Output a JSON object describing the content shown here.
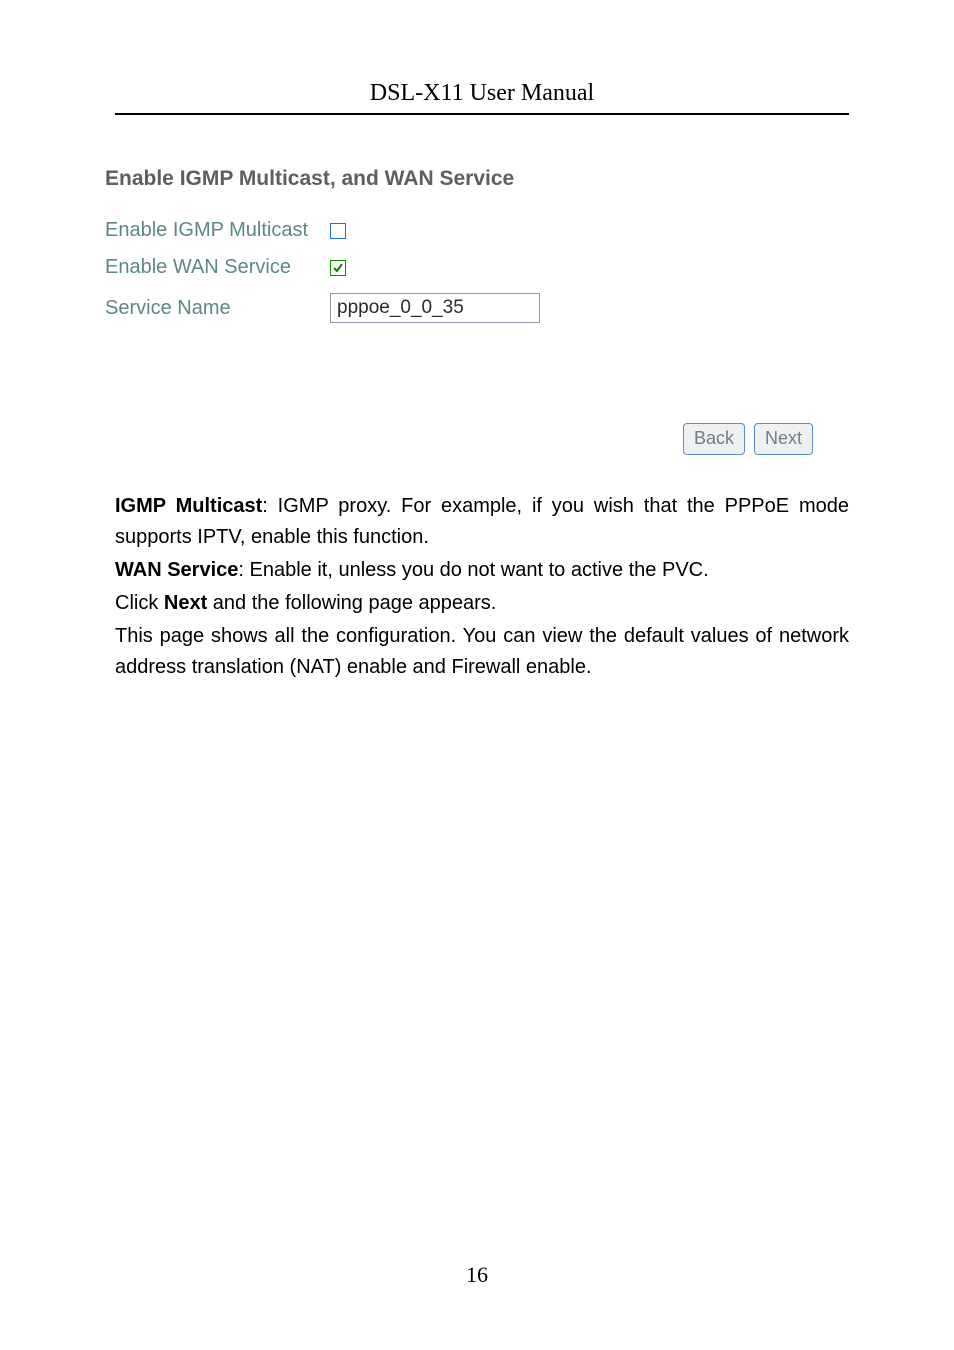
{
  "header": {
    "title": "DSL-X11 User Manual"
  },
  "ui": {
    "title": "Enable IGMP Multicast, and WAN Service",
    "rows": {
      "igmp": {
        "label": "Enable IGMP Multicast",
        "checked": false
      },
      "wan": {
        "label": "Enable WAN Service",
        "checked": true
      },
      "svc": {
        "label": "Service Name",
        "value": "pppoe_0_0_35"
      }
    },
    "buttons": {
      "back": "Back",
      "next": "Next"
    }
  },
  "body": {
    "p1_strong": "IGMP Multicast",
    "p1_rest": ": IGMP proxy. For example, if you wish that the PPPoE mode supports IPTV, enable this function.",
    "p2_strong": "WAN Service",
    "p2_rest": ": Enable it, unless you do not want to active the PVC.",
    "p3_a": "Click ",
    "p3_strong": "Next",
    "p3_b": " and the following page appears.",
    "p4": "This page shows all the configuration. You can view the default values of network address translation (NAT) enable and Firewall enable."
  },
  "page_number": "16"
}
